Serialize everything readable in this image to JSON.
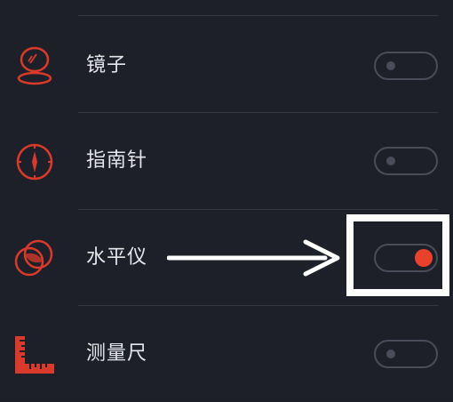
{
  "settings": {
    "items": [
      {
        "label": "镜子",
        "icon": "mirror-icon",
        "enabled": false
      },
      {
        "label": "指南针",
        "icon": "compass-icon",
        "enabled": false
      },
      {
        "label": "水平仪",
        "icon": "level-icon",
        "enabled": true
      },
      {
        "label": "测量尺",
        "icon": "ruler-icon",
        "enabled": false
      }
    ]
  },
  "colors": {
    "background": "#1e2029",
    "accent": "#e8412c",
    "icon": "#d93a2b",
    "toggle_off": "#4a4d59",
    "annotation": "#ffffff"
  }
}
